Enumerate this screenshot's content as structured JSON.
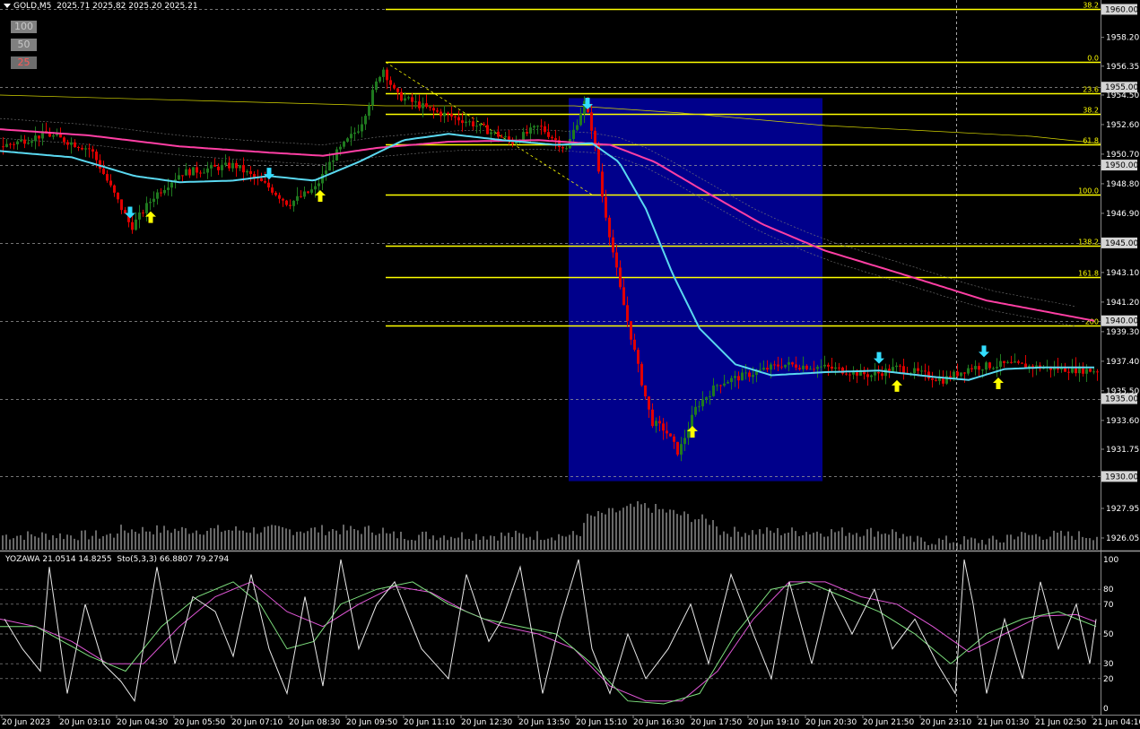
{
  "header": {
    "symbol": "GOLD,M5",
    "ohlc": "2025.71 2025.82 2025.20 2025.21"
  },
  "buttons": [
    "100",
    "50",
    "25"
  ],
  "indicator": {
    "label": "YOZAWA 21.0514 14.8255",
    "stoch": "Sto(5,3,3) 66.8807 79.2794"
  },
  "colors": {
    "background": "#000000",
    "bull": "#1f7a1f",
    "bear": "#e00000",
    "ma_fast": "#5ad8f0",
    "ma_slow": "#ff3fa4",
    "fib": "#ffff00",
    "zone": "#00008b",
    "arrow_down": "#33ddff",
    "arrow_up": "#ffff00"
  },
  "chart_data": {
    "type": "line",
    "price_axis": {
      "ylim": [
        1925.3,
        1960.6
      ],
      "ticks": [
        "1958.20",
        "1956.35",
        "1954.50",
        "1952.60",
        "1950.70",
        "1948.80",
        "1946.90",
        "1943.10",
        "1941.20",
        "1939.30",
        "1937.40",
        "1935.50",
        "1933.60",
        "1931.75",
        "1927.95",
        "1926.05"
      ],
      "highlighted_levels": [
        "1960.00",
        "1955.00",
        "1950.00",
        "1945.00",
        "1940.00",
        "1935.00",
        "1930.00"
      ]
    },
    "fibonacci": [
      {
        "label": "38.2",
        "price": 1960.0
      },
      {
        "label": "0.0",
        "price": 1956.6
      },
      {
        "label": "23.6",
        "price": 1954.6
      },
      {
        "label": "38.2",
        "price": 1953.3
      },
      {
        "label": "61.8",
        "price": 1951.3
      },
      {
        "label": "100.0",
        "price": 1948.1
      },
      {
        "label": "138.2",
        "price": 1944.8
      },
      {
        "label": "161.8",
        "price": 1942.8
      },
      {
        "label": "200",
        "price": 1939.7
      }
    ],
    "time_labels": [
      "20 Jun 2023",
      "20 Jun 03:10",
      "20 Jun 04:30",
      "20 Jun 05:50",
      "20 Jun 07:10",
      "20 Jun 08:30",
      "20 Jun 09:50",
      "20 Jun 11:10",
      "20 Jun 12:30",
      "20 Jun 13:50",
      "20 Jun 15:10",
      "20 Jun 16:30",
      "20 Jun 17:50",
      "20 Jun 19:10",
      "20 Jun 20:30",
      "20 Jun 21:50",
      "20 Jun 23:10",
      "21 Jun 01:30",
      "21 Jun 02:50",
      "21 Jun 04:10"
    ],
    "price_keypoints": [
      [
        0,
        1951.2
      ],
      [
        50,
        1952.0
      ],
      [
        100,
        1951.0
      ],
      [
        145,
        1946.0
      ],
      [
        170,
        1948.0
      ],
      [
        200,
        1949.5
      ],
      [
        260,
        1950.0
      ],
      [
        300,
        1948.5
      ],
      [
        320,
        1947.5
      ],
      [
        350,
        1948.5
      ],
      [
        370,
        1950.5
      ],
      [
        400,
        1952.5
      ],
      [
        425,
        1956.3
      ],
      [
        440,
        1954.5
      ],
      [
        480,
        1953.5
      ],
      [
        520,
        1952.8
      ],
      [
        570,
        1951.5
      ],
      [
        600,
        1952.5
      ],
      [
        630,
        1951.0
      ],
      [
        650,
        1954.0
      ],
      [
        660,
        1952.0
      ],
      [
        670,
        1948.0
      ],
      [
        690,
        1942.0
      ],
      [
        710,
        1937.0
      ],
      [
        725,
        1933.5
      ],
      [
        740,
        1933.0
      ],
      [
        755,
        1931.5
      ],
      [
        775,
        1934.5
      ],
      [
        800,
        1936.0
      ],
      [
        830,
        1936.5
      ],
      [
        870,
        1937.2
      ],
      [
        920,
        1937.0
      ],
      [
        970,
        1936.5
      ],
      [
        1000,
        1937.0
      ],
      [
        1050,
        1936.2
      ],
      [
        1080,
        1937.0
      ],
      [
        1120,
        1937.2
      ],
      [
        1160,
        1937.0
      ],
      [
        1220,
        1936.8
      ]
    ],
    "ma_fast_keypoints": [
      [
        0,
        1950.9
      ],
      [
        80,
        1950.5
      ],
      [
        150,
        1949.3
      ],
      [
        200,
        1948.9
      ],
      [
        260,
        1949.0
      ],
      [
        300,
        1949.3
      ],
      [
        350,
        1949.0
      ],
      [
        400,
        1950.2
      ],
      [
        450,
        1951.6
      ],
      [
        500,
        1952.0
      ],
      [
        560,
        1951.6
      ],
      [
        620,
        1951.3
      ],
      [
        660,
        1951.4
      ],
      [
        690,
        1950.2
      ],
      [
        720,
        1947.2
      ],
      [
        750,
        1943.0
      ],
      [
        780,
        1939.5
      ],
      [
        820,
        1937.2
      ],
      [
        860,
        1936.5
      ],
      [
        920,
        1936.7
      ],
      [
        980,
        1936.8
      ],
      [
        1040,
        1936.4
      ],
      [
        1080,
        1936.2
      ],
      [
        1120,
        1936.9
      ],
      [
        1160,
        1937.0
      ],
      [
        1220,
        1937.0
      ]
    ],
    "ma_slow_keypoints": [
      [
        0,
        1952.3
      ],
      [
        100,
        1951.9
      ],
      [
        200,
        1951.2
      ],
      [
        300,
        1950.8
      ],
      [
        360,
        1950.6
      ],
      [
        420,
        1951.1
      ],
      [
        500,
        1951.5
      ],
      [
        600,
        1951.6
      ],
      [
        680,
        1951.3
      ],
      [
        730,
        1950.2
      ],
      [
        780,
        1948.5
      ],
      [
        850,
        1946.2
      ],
      [
        920,
        1944.5
      ],
      [
        1000,
        1943.1
      ],
      [
        1100,
        1941.3
      ],
      [
        1220,
        1940.0
      ]
    ],
    "signals_down": [
      145,
      300,
      655,
      980,
      1097
    ],
    "signals_up": [
      168,
      357,
      772,
      1000,
      1113
    ],
    "oscillator": {
      "ylim": [
        0,
        100
      ],
      "levels": [
        100,
        80,
        70,
        50,
        30,
        20,
        0
      ],
      "fast_keypoints": [
        [
          5,
          60
        ],
        [
          25,
          40
        ],
        [
          45,
          25
        ],
        [
          55,
          95
        ],
        [
          75,
          10
        ],
        [
          95,
          70
        ],
        [
          115,
          30
        ],
        [
          135,
          18
        ],
        [
          150,
          5
        ],
        [
          175,
          95
        ],
        [
          195,
          30
        ],
        [
          215,
          75
        ],
        [
          240,
          65
        ],
        [
          260,
          35
        ],
        [
          280,
          90
        ],
        [
          300,
          40
        ],
        [
          320,
          10
        ],
        [
          340,
          75
        ],
        [
          360,
          15
        ],
        [
          380,
          100
        ],
        [
          400,
          40
        ],
        [
          420,
          70
        ],
        [
          440,
          85
        ],
        [
          470,
          40
        ],
        [
          500,
          20
        ],
        [
          520,
          90
        ],
        [
          545,
          45
        ],
        [
          560,
          60
        ],
        [
          580,
          95
        ],
        [
          605,
          10
        ],
        [
          625,
          60
        ],
        [
          645,
          100
        ],
        [
          660,
          40
        ],
        [
          680,
          10
        ],
        [
          700,
          50
        ],
        [
          720,
          20
        ],
        [
          745,
          40
        ],
        [
          770,
          70
        ],
        [
          790,
          30
        ],
        [
          815,
          90
        ],
        [
          840,
          50
        ],
        [
          860,
          20
        ],
        [
          880,
          85
        ],
        [
          905,
          30
        ],
        [
          925,
          80
        ],
        [
          950,
          50
        ],
        [
          975,
          80
        ],
        [
          995,
          40
        ],
        [
          1020,
          60
        ],
        [
          1045,
          30
        ],
        [
          1065,
          10
        ],
        [
          1075,
          100
        ],
        [
          1085,
          70
        ],
        [
          1100,
          10
        ],
        [
          1120,
          60
        ],
        [
          1140,
          20
        ],
        [
          1160,
          85
        ],
        [
          1180,
          40
        ],
        [
          1200,
          70
        ],
        [
          1215,
          30
        ],
        [
          1222,
          60
        ]
      ],
      "k_keypoints": [
        [
          0,
          55
        ],
        [
          40,
          55
        ],
        [
          70,
          45
        ],
        [
          100,
          35
        ],
        [
          140,
          25
        ],
        [
          180,
          55
        ],
        [
          220,
          75
        ],
        [
          260,
          85
        ],
        [
          290,
          70
        ],
        [
          320,
          40
        ],
        [
          350,
          45
        ],
        [
          380,
          70
        ],
        [
          420,
          80
        ],
        [
          460,
          85
        ],
        [
          500,
          70
        ],
        [
          540,
          60
        ],
        [
          580,
          55
        ],
        [
          620,
          50
        ],
        [
          660,
          30
        ],
        [
          700,
          5
        ],
        [
          740,
          3
        ],
        [
          780,
          10
        ],
        [
          820,
          50
        ],
        [
          860,
          80
        ],
        [
          900,
          85
        ],
        [
          940,
          75
        ],
        [
          980,
          65
        ],
        [
          1020,
          50
        ],
        [
          1060,
          30
        ],
        [
          1100,
          50
        ],
        [
          1140,
          60
        ],
        [
          1180,
          65
        ],
        [
          1222,
          55
        ]
      ],
      "d_keypoints": [
        [
          0,
          60
        ],
        [
          40,
          55
        ],
        [
          80,
          45
        ],
        [
          120,
          30
        ],
        [
          160,
          30
        ],
        [
          200,
          55
        ],
        [
          240,
          75
        ],
        [
          280,
          85
        ],
        [
          320,
          65
        ],
        [
          360,
          55
        ],
        [
          400,
          70
        ],
        [
          440,
          82
        ],
        [
          480,
          78
        ],
        [
          520,
          65
        ],
        [
          560,
          55
        ],
        [
          600,
          50
        ],
        [
          640,
          40
        ],
        [
          680,
          15
        ],
        [
          720,
          5
        ],
        [
          760,
          5
        ],
        [
          800,
          25
        ],
        [
          840,
          60
        ],
        [
          880,
          85
        ],
        [
          920,
          85
        ],
        [
          960,
          75
        ],
        [
          1000,
          70
        ],
        [
          1040,
          55
        ],
        [
          1080,
          38
        ],
        [
          1120,
          50
        ],
        [
          1160,
          62
        ],
        [
          1200,
          63
        ],
        [
          1222,
          58
        ]
      ]
    }
  }
}
